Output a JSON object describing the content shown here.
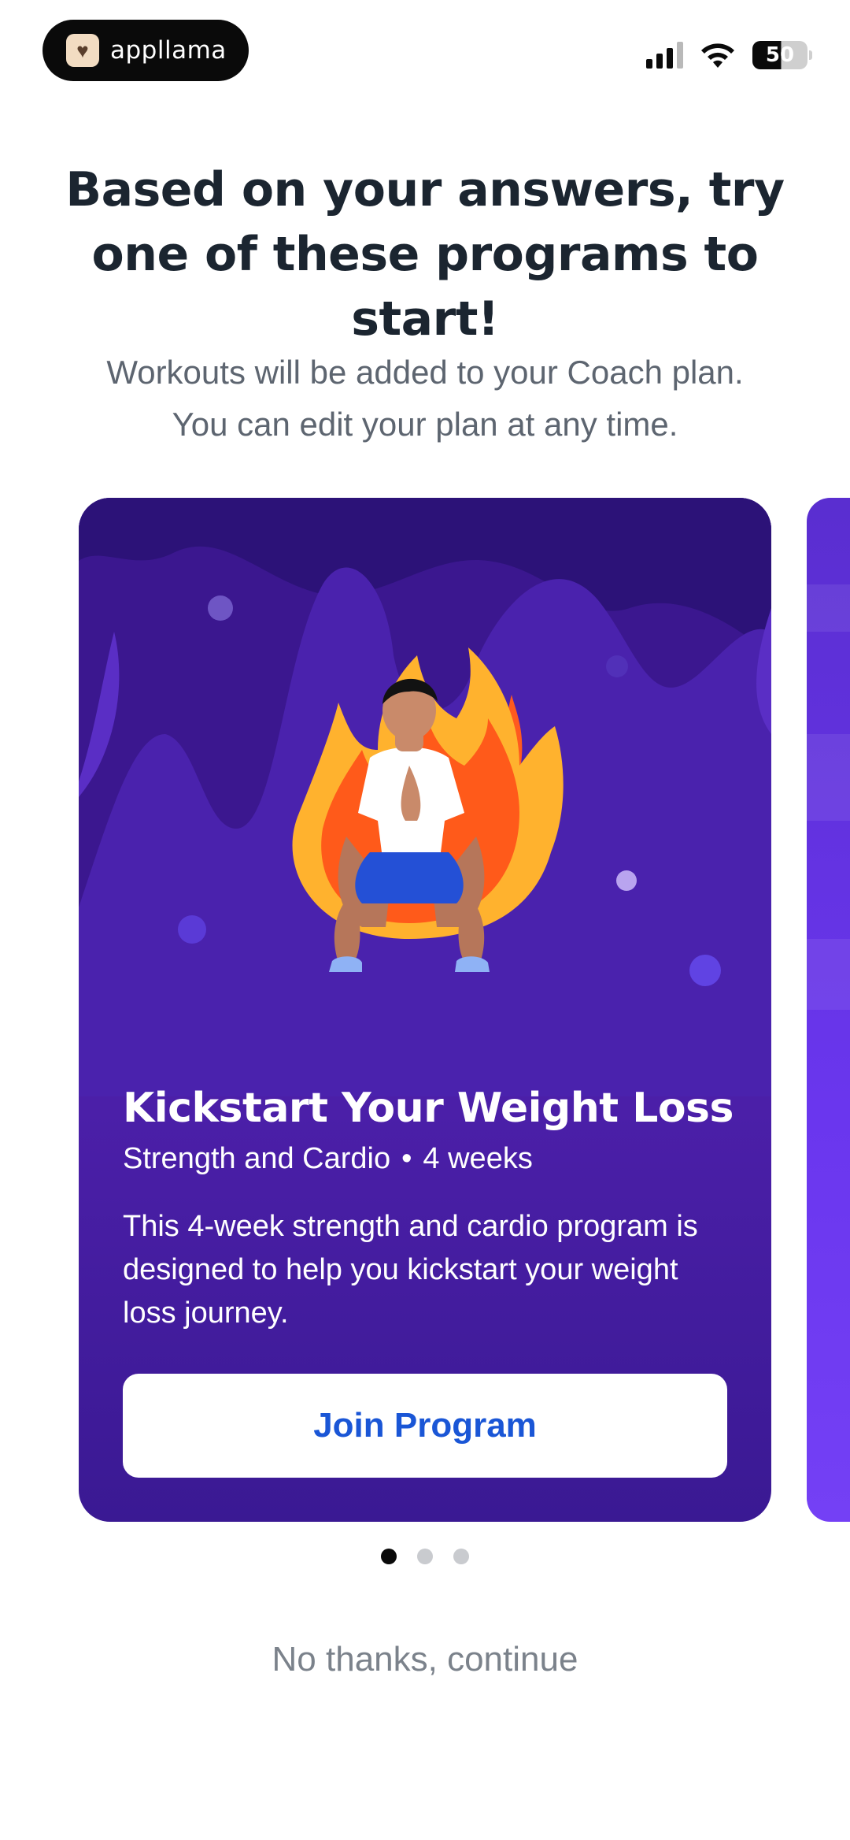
{
  "status_bar": {
    "brand_name": "appllama",
    "battery_level": "50",
    "icons": [
      "signal-icon",
      "wifi-icon",
      "battery-icon"
    ]
  },
  "header": {
    "title_line1": "Based on your answers, try",
    "title_line2": "one of these programs to start!",
    "subtitle_line1": "Workouts will be added to your Coach plan.",
    "subtitle_line2": "You can edit your plan at any time."
  },
  "program": {
    "title": "Kickstart Your Weight Loss",
    "category": "Strength and Cardio",
    "separator": "•",
    "duration": "4 weeks",
    "description": "This 4-week strength and cardio program is designed to help you kickstart your weight loss journey.",
    "button_label": "Join Program",
    "colors": {
      "card_bg": "#4a1fb0",
      "button_text": "#1a56d6"
    }
  },
  "pager": {
    "total": 3,
    "active_index": 0
  },
  "footer": {
    "skip_label": "No thanks, continue"
  }
}
